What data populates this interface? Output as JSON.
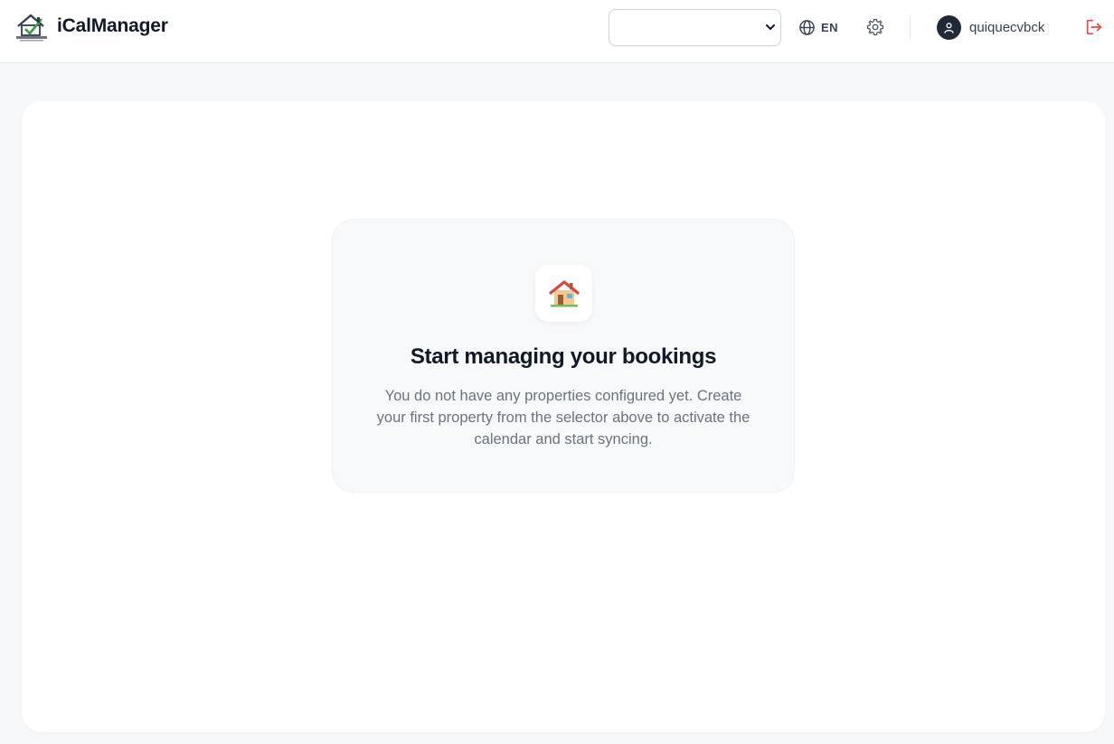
{
  "app": {
    "title": "iCalManager",
    "logo_icon": "house-checkmark-logo"
  },
  "header": {
    "property_select": {
      "selected": "",
      "icon": "chevron-down-icon"
    },
    "language": {
      "label": "EN",
      "icon": "globe-icon"
    },
    "settings": {
      "icon": "gear-icon"
    },
    "user": {
      "name": "quiquecvbck",
      "icon": "user-icon"
    },
    "logout": {
      "icon": "logout-icon",
      "color": "#ef4444"
    }
  },
  "empty_state": {
    "icon": "house-icon",
    "title": "Start managing your bookings",
    "description": "You do not have any properties configured yet. Create your first property from the selector above to activate the calendar and start syncing."
  },
  "colors": {
    "background": "#f7f8fa",
    "card": "#ffffff",
    "title_text": "#111827",
    "muted_text": "#6b7280",
    "avatar": "#1f2937",
    "danger": "#ef4444"
  }
}
